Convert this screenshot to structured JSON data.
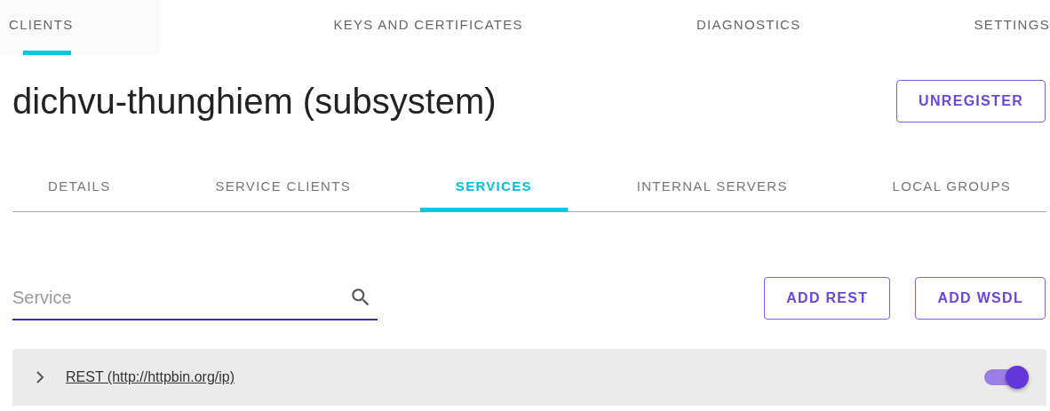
{
  "main_tabs": [
    {
      "label": "CLIENTS",
      "selected": true
    },
    {
      "label": "KEYS AND CERTIFICATES",
      "selected": false
    },
    {
      "label": "DIAGNOSTICS",
      "selected": false
    },
    {
      "label": "SETTINGS",
      "selected": false
    }
  ],
  "title": "dichvu-thunghiem (subsystem)",
  "unregister_button": "UNREGISTER",
  "sub_tabs": [
    {
      "label": "DETAILS",
      "selected": false
    },
    {
      "label": "SERVICE CLIENTS",
      "selected": false
    },
    {
      "label": "SERVICES",
      "selected": true
    },
    {
      "label": "INTERNAL SERVERS",
      "selected": false
    },
    {
      "label": "LOCAL GROUPS",
      "selected": false
    }
  ],
  "search": {
    "placeholder": "Service"
  },
  "buttons": [
    "ADD REST",
    "ADD WSDL"
  ],
  "services": [
    {
      "name": "REST (http://httpbin.org/ip)",
      "expanded": false,
      "enabled": true
    }
  ]
}
